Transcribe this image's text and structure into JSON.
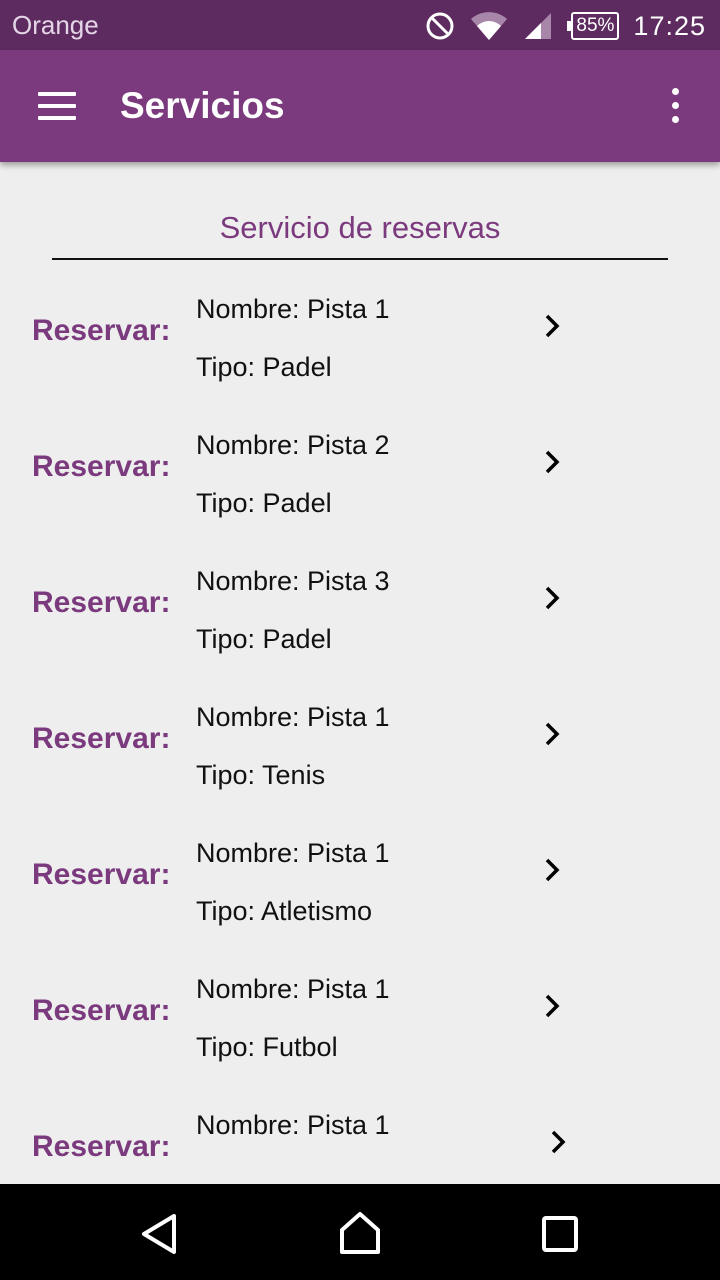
{
  "status_bar": {
    "carrier": "Orange",
    "battery_percent": "85%",
    "time": "17:25",
    "icons": [
      "do-not-disturb-icon",
      "wifi-icon",
      "signal-icon",
      "battery-icon"
    ]
  },
  "app_bar": {
    "title": "Servicios",
    "menu_icon": "hamburger-menu-icon",
    "overflow_icon": "more-vert-icon"
  },
  "main": {
    "section_title": "Servicio de reservas",
    "rows": [
      {
        "action": "Reservar:",
        "name": "Nombre: Pista 1",
        "type": "Tipo: Padel"
      },
      {
        "action": "Reservar:",
        "name": "Nombre: Pista 2",
        "type": "Tipo: Padel"
      },
      {
        "action": "Reservar:",
        "name": "Nombre: Pista 3",
        "type": "Tipo: Padel"
      },
      {
        "action": "Reservar:",
        "name": "Nombre: Pista 1",
        "type": "Tipo: Tenis"
      },
      {
        "action": "Reservar:",
        "name": "Nombre: Pista 1",
        "type": "Tipo: Atletismo"
      },
      {
        "action": "Reservar:",
        "name": "Nombre: Pista 1",
        "type": "Tipo: Futbol"
      },
      {
        "action": "Reservar:",
        "name": "Nombre: Pista 1",
        "type": ""
      }
    ]
  },
  "nav_bar": {
    "buttons": [
      "back-icon",
      "home-icon",
      "recents-icon"
    ]
  },
  "colors": {
    "status_bar": "#5e2b61",
    "app_bar": "#7b3a7d",
    "accent": "#7b3a7d",
    "background": "#eeeeee"
  }
}
